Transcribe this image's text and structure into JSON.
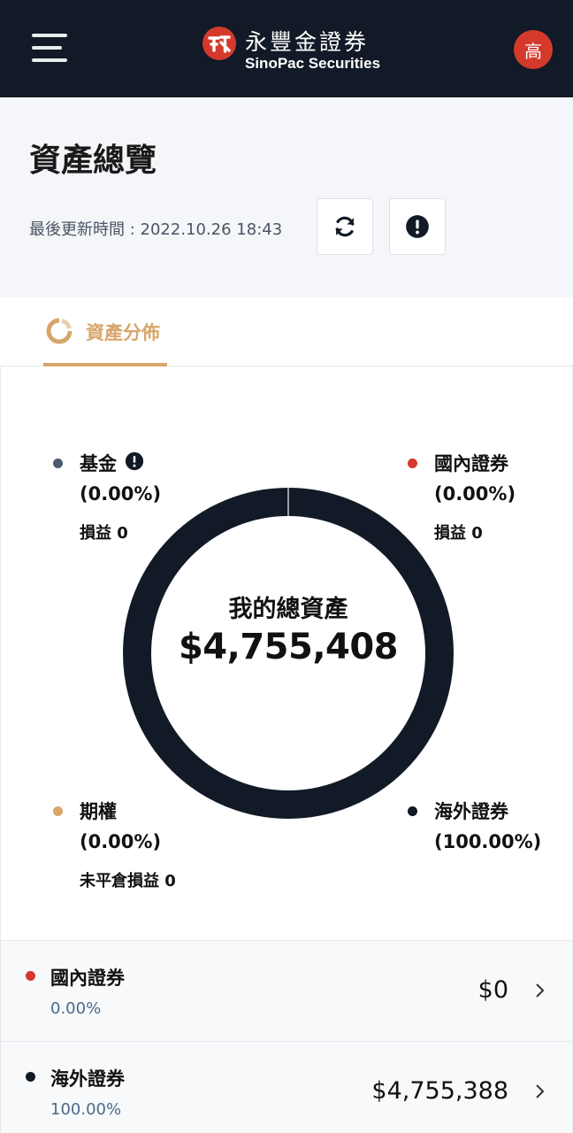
{
  "header": {
    "brand_cn": "永豐金證券",
    "brand_en": "SinoPac Securities",
    "avatar_text": "高"
  },
  "page": {
    "title": "資產總覽",
    "last_updated": "最後更新時間 : 2022.10.26 18:43"
  },
  "tabs": [
    {
      "label": "資產分佈",
      "active": true
    }
  ],
  "summary": {
    "label": "我的總資產",
    "total": "$4,755,408"
  },
  "legend": {
    "fund": {
      "name": "基金",
      "pct": "(0.00%)",
      "pl": "損益 0",
      "color": "#4a5a70"
    },
    "domestic": {
      "name": "國內證券",
      "pct": "(0.00%)",
      "pl": "損益 0",
      "color": "#d43a2c"
    },
    "options": {
      "name": "期權",
      "pct": "(0.00%)",
      "pl": "未平倉損益 0",
      "color": "#d8a66b"
    },
    "overseas": {
      "name": "海外證券",
      "pct": "(100.00%)",
      "color": "#111a26"
    }
  },
  "chart_data": {
    "type": "pie",
    "categories": [
      "國內證券",
      "海外證券",
      "期權",
      "基金"
    ],
    "values": [
      0,
      100,
      0,
      0
    ],
    "colors": [
      "#d43a2c",
      "#111a26",
      "#d8a66b",
      "#4a5a70"
    ],
    "title": "我的總資產",
    "legend": "around"
  },
  "rows": [
    {
      "name": "國內證券",
      "pct": "0.00%",
      "amount": "$0",
      "color": "#d43a2c"
    },
    {
      "name": "海外證券",
      "pct": "100.00%",
      "amount": "$4,755,388",
      "color": "#111a26"
    }
  ],
  "colors": {
    "header_bg": "#111a26",
    "accent_gold": "#d8a66b",
    "brand_red": "#d43a2c"
  }
}
